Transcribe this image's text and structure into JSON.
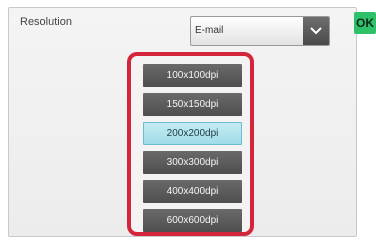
{
  "setting": {
    "label": "Resolution"
  },
  "select": {
    "value": "E-mail",
    "arrow_icon": "chevron-down-icon"
  },
  "ok": {
    "label": "OK"
  },
  "dropdown": {
    "options": [
      {
        "label": "100x100dpi",
        "selected": false
      },
      {
        "label": "150x150dpi",
        "selected": false
      },
      {
        "label": "200x200dpi",
        "selected": true
      },
      {
        "label": "300x300dpi",
        "selected": false
      },
      {
        "label": "400x400dpi",
        "selected": false
      },
      {
        "label": "600x600dpi",
        "selected": false
      }
    ]
  },
  "colors": {
    "highlight_border": "#d4253a",
    "ok_button": "#2fc06a",
    "selected_option": "#9fdbe8"
  }
}
